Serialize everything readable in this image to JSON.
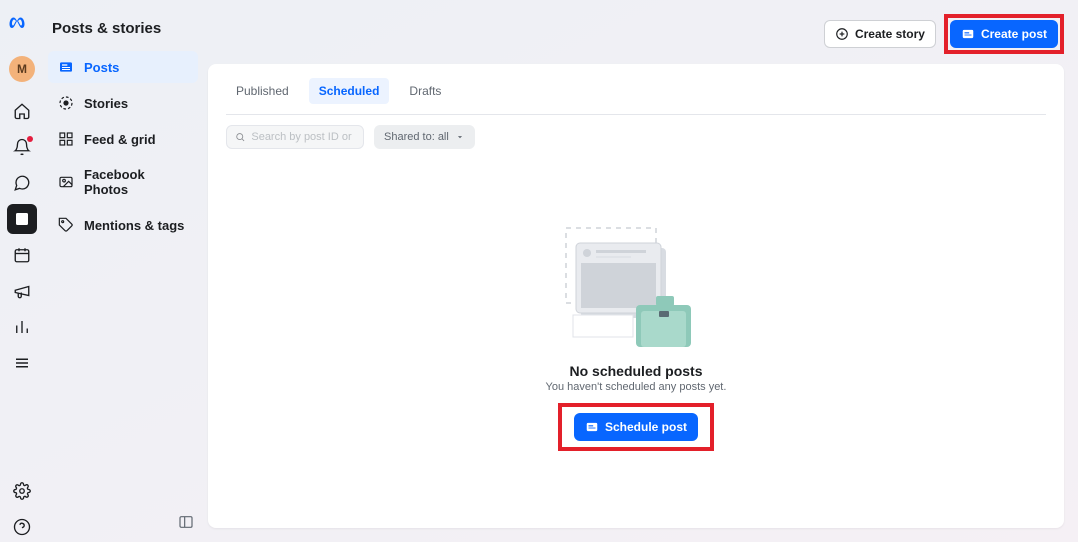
{
  "page_title": "Posts & stories",
  "avatar_initial": "M",
  "header": {
    "create_story": "Create story",
    "create_post": "Create post"
  },
  "sidebar": {
    "items": [
      {
        "label": "Posts"
      },
      {
        "label": "Stories"
      },
      {
        "label": "Feed & grid"
      },
      {
        "label": "Facebook Photos"
      },
      {
        "label": "Mentions & tags"
      }
    ]
  },
  "tabs": [
    {
      "label": "Published"
    },
    {
      "label": "Scheduled"
    },
    {
      "label": "Drafts"
    }
  ],
  "search": {
    "placeholder": "Search by post ID or caption"
  },
  "filter": {
    "label": "Shared to: all"
  },
  "empty": {
    "title": "No scheduled posts",
    "subtitle": "You haven't scheduled any posts yet.",
    "cta": "Schedule post"
  }
}
